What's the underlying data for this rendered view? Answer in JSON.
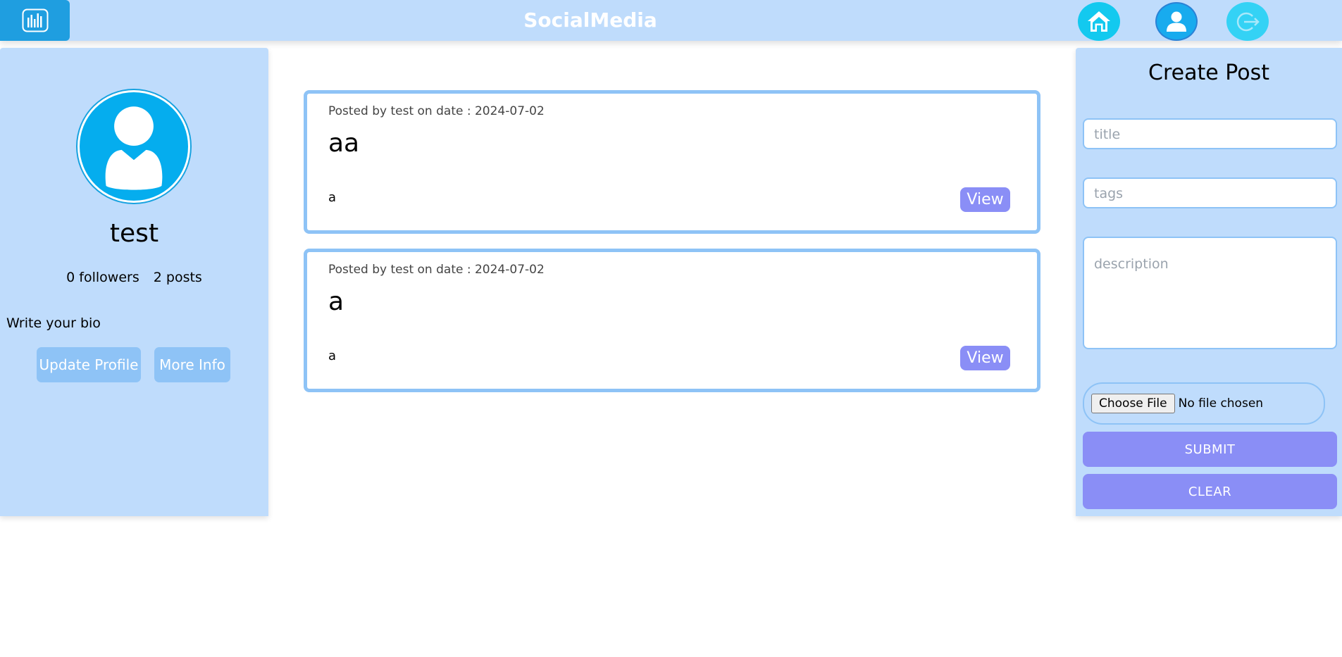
{
  "header": {
    "app_title": "SocialMedia",
    "logo_icon": "bar-chart-icon",
    "nav": [
      {
        "name": "home",
        "icon": "home-icon"
      },
      {
        "name": "profile",
        "icon": "user-icon"
      },
      {
        "name": "logout",
        "icon": "logout-icon"
      }
    ]
  },
  "profile": {
    "username": "test",
    "followers": "0 followers",
    "posts": "2 posts",
    "bio_placeholder": "Write your bio",
    "update_button": "Update Profile",
    "more_info_button": "More Info"
  },
  "posts": [
    {
      "meta": "Posted by test on date : 2024-07-02",
      "title": "aa",
      "description": "a",
      "view_label": "View"
    },
    {
      "meta": "Posted by test on date : 2024-07-02",
      "title": "a",
      "description": "a",
      "view_label": "View"
    }
  ],
  "create_post": {
    "heading": "Create Post",
    "title_placeholder": "title",
    "tags_placeholder": "tags",
    "description_placeholder": "description",
    "file_button": "Choose File",
    "file_status": "No file chosen",
    "submit_label": "SUBMIT",
    "clear_label": "CLEAR"
  },
  "colors": {
    "panel_bg": "#bfdcfc",
    "accent": "#8a8ef6",
    "border": "#8ec3f6",
    "avatar_bg": "#05adee"
  }
}
